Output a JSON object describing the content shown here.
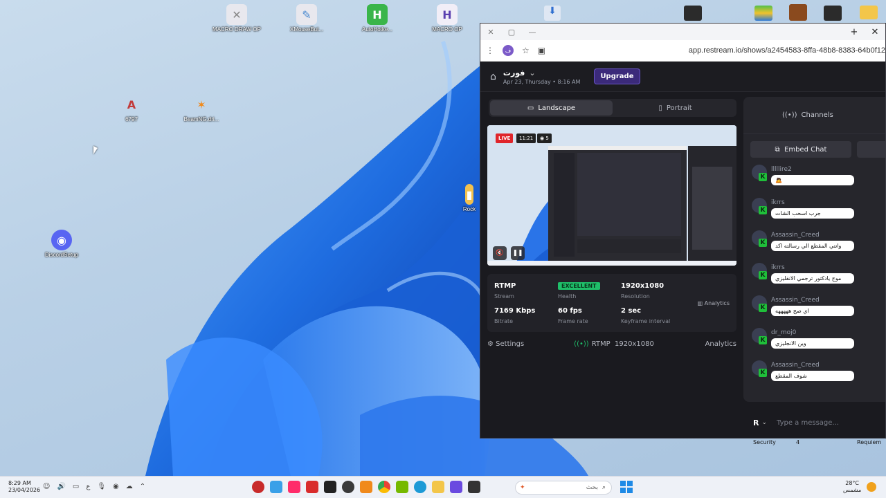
{
  "desktop": {
    "icons": [
      {
        "label": "MACRO DRAW OP",
        "color": "#e8e8ee",
        "glyph": "✕"
      },
      {
        "label": "XMouseBut...",
        "color": "#e8e8ee",
        "glyph": "✎"
      },
      {
        "label": "AutoHotke...",
        "color": "#3ab54a",
        "glyph": "H"
      },
      {
        "label": "MACRO OP",
        "color": "#f1eef7",
        "glyph": "H"
      },
      {
        "label": "6797",
        "color": "#c23a3a",
        "glyph": "A"
      },
      {
        "label": "BeamNG.dri...",
        "color": "#f08a1c",
        "glyph": "✶"
      },
      {
        "label": "DiscordSetup",
        "color": "#5865f2",
        "glyph": "◉"
      },
      {
        "label": "Rock",
        "color": "#f2c14e",
        "glyph": "▮"
      }
    ]
  },
  "browser": {
    "url": "app.restream.io/shows/a2454583-8ffa-48b8-8383-64b0f12",
    "avatar_letter": "ف"
  },
  "app": {
    "show_name": "فورت",
    "show_date": "Apr 23, Thursday • 8:16 AM",
    "upgrade_label": "Upgrade",
    "tabs": {
      "landscape": "Landscape",
      "portrait": "Portrait"
    },
    "preview": {
      "live": "LIVE",
      "timer": "11:21",
      "viewers": "5"
    },
    "stats": {
      "protocol": "RTMP",
      "protocol_label": "Stream",
      "health": "EXCELLENT",
      "health_label": "Health",
      "resolution": "1920x1080",
      "resolution_label": "Resolution",
      "bitrate": "7169 Kbps",
      "bitrate_label": "Bitrate",
      "framerate": "60 fps",
      "framerate_label": "Frame rate",
      "keyframe": "2 sec",
      "keyframe_label": "Keyframe interval",
      "analytics_label": "Analytics"
    },
    "footer": {
      "settings": "Settings",
      "rtmp": "RTMP",
      "res": "1920x1080",
      "analytics": "Analytics"
    }
  },
  "chat": {
    "channels_label": "Channels",
    "embed_label": "Embed Chat",
    "placeholder": "Type a message...",
    "sender_letter": "R",
    "messages": [
      {
        "name": "lllllire2",
        "text": "🙇"
      },
      {
        "name": "ikrrs",
        "text": "جرب اسحب الشات"
      },
      {
        "name": "Assassin_Creed",
        "text": "وانتي المقطع الي رسالته اكد"
      },
      {
        "name": "ikrrs",
        "text": "موج يادكتور ترجمي الانقليزي"
      },
      {
        "name": "Assassin_Creed",
        "text": "اي صح هههههه"
      },
      {
        "name": "dr_moj0",
        "text": "وين الانجليزي"
      },
      {
        "name": "Assassin_Creed",
        "text": "شوف المقطع"
      }
    ]
  },
  "behind": {
    "security": "Security",
    "num": "4",
    "requiem": "Requiem"
  },
  "taskbar": {
    "time": "8:29 AM",
    "date": "23/04/2026",
    "lang": "ع",
    "search_placeholder": "بحث",
    "temp": "28°C",
    "weather": "مشمس"
  }
}
